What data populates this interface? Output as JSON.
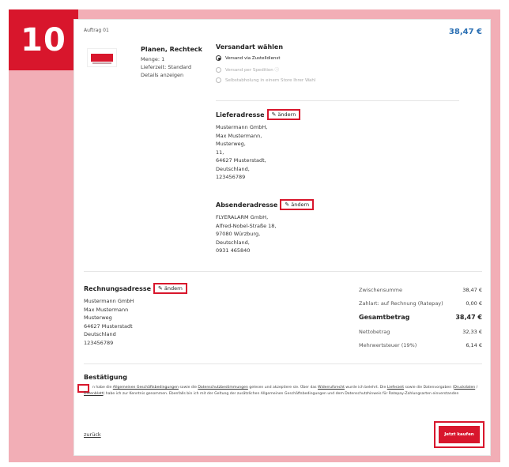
{
  "step_number": "10",
  "order": {
    "label": "Auftrag 01",
    "total": "38,47 €"
  },
  "product": {
    "title": "Planen, Rechteck",
    "quantity": "Menge: 1",
    "delivery_time": "Lieferzeit: Standard",
    "details_link": "Details anzeigen",
    "image_icon": "banner-product-image"
  },
  "shipping": {
    "heading": "Versandart wählen",
    "options": [
      {
        "label": "Versand via Zustelldienst",
        "selected": true,
        "enabled": true
      },
      {
        "label": "Versand per Spedition ⓘ",
        "selected": false,
        "enabled": false
      },
      {
        "label": "Selbstabholung in einem Store Ihrer Wahl",
        "selected": false,
        "enabled": false
      }
    ]
  },
  "delivery_address": {
    "heading": "Lieferadresse",
    "edit_label": "ändern",
    "lines": [
      "Mustermann GmbH,",
      "Max Mustermann,",
      "Musterweg,",
      "11,",
      "64627 Musterstadt,",
      "Deutschland,",
      "123456789"
    ]
  },
  "sender_address": {
    "heading": "Absenderadresse",
    "edit_label": "ändern",
    "lines": [
      "FLYERALARM GmbH,",
      "Alfred-Nobel-Straße 18,",
      "97080 Würzburg,",
      "Deutschland,",
      "0931 465840"
    ]
  },
  "billing_address": {
    "heading": "Rechnungsadresse",
    "edit_label": "ändern",
    "lines": [
      "Mustermann GmbH",
      "Max Mustermann",
      "Musterweg",
      "64627 Musterstadt",
      "Deutschland",
      "123456789"
    ]
  },
  "summary": {
    "subtotal_label": "Zwischensumme",
    "subtotal_value": "38,47 €",
    "payment_label": "Zahlart: auf Rechnung (Ratepay)",
    "payment_value": "0,00 €",
    "total_label": "Gesamtbetrag",
    "total_value": "38,47 €",
    "net_label": "Nettobetrag",
    "net_value": "32,33 €",
    "vat_label": "Mehrwertsteuer (19%)",
    "vat_value": "6,14 €"
  },
  "confirmation": {
    "heading": "Bestätigung",
    "t1": "n habe die ",
    "agb": "Allgemeinen Geschäftsbedingungen",
    "t2": " sowie die ",
    "privacy": "Datenschutzbestimmungen",
    "t3": " gelesen und akzeptiere sie. Über das ",
    "withdrawal": "Widerrufsrecht",
    "t4": " wurde ich belehrt. Die ",
    "lieferzeit": "Lieferzeit",
    "t5": " sowie die Datenvorgaben (",
    "druckdaten": "Druckdaten",
    "t6": " / ",
    "datenblatt": "Datenblatt",
    "t7": ") habe ich zur Kenntnis genommen. Ebenfalls bin ich mit der Geltung der zusätzlichen Allgemeinen Geschäftsbedingungen und dem Datenschutzhinweis für Ratepay-Zahlungsarten einverstanden"
  },
  "back_link": "zurück",
  "buy_button": "Jetzt kaufen",
  "colors": {
    "accent": "#d8162c",
    "frame": "#f2aeb6",
    "link_price": "#2a6fb3"
  }
}
